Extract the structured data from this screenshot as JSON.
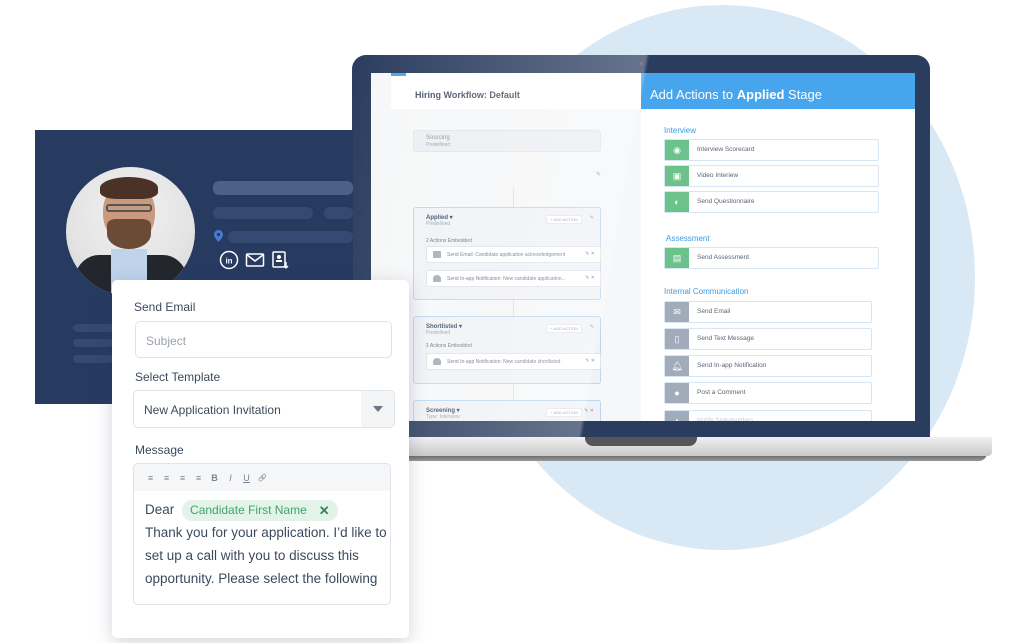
{
  "workflow": {
    "title": "Hiring Workflow: Default",
    "stages": [
      {
        "name": "Sourcing",
        "subtitle": "Predefined"
      },
      {
        "name": "Applied ▾",
        "subtitle": "Predefined",
        "add_action": "+ ADD ACTION",
        "actions_count": "2 Actions Embedded",
        "actions": [
          {
            "icon": "mail-icon",
            "text": "Send Email: Candidate application acknowledgement"
          },
          {
            "icon": "bell-icon",
            "text": "Send In-app Notification: New candidate application..."
          }
        ]
      },
      {
        "name": "Shortlisted ▾",
        "subtitle": "Predefined",
        "add_action": "+ ADD ACTION",
        "actions_count": "1 Actions Embedded",
        "actions": [
          {
            "icon": "bell-icon",
            "text": "Send In-app Notification: New candidate shortlisted"
          }
        ]
      },
      {
        "name": "Screening ▾",
        "subtitle": "Type: Interview",
        "add_action": "+ ADD ACTION"
      }
    ]
  },
  "actions_panel": {
    "title_prefix": "Add Actions to ",
    "title_bold": "Applied",
    "title_suffix": " Stage",
    "sections": [
      {
        "title": "Interview",
        "items": [
          "Interview Scorecard",
          "Video Interiew",
          "Send Questionnaire"
        ]
      },
      {
        "title": "Assessment",
        "items": [
          "Send Assessment"
        ]
      },
      {
        "title": "Internal Communication",
        "items": [
          "Send Email",
          "Send Text Message",
          "Send In-app Notification",
          "Post a Comment",
          "Notify Stakeholders"
        ]
      }
    ]
  },
  "email_form": {
    "title": "Send Email",
    "subject_placeholder": "Subject",
    "template_label": "Select Template",
    "template_value": "New Application Invitation",
    "message_label": "Message",
    "toolbar": [
      "≡",
      "≡",
      "≡",
      "≡",
      "B",
      "I",
      "U",
      "🔗"
    ],
    "greeting": "Dear",
    "merge_tag": "Candidate First Name",
    "merge_tag_remove": "✕",
    "body": "Thank you for your application. I’d like to set up a call with you to discuss this opportunity. Please select the following"
  },
  "colors": {
    "accent_blue": "#46a5ec",
    "navy": "#273a60",
    "green": "#6cc28b",
    "circle_bg": "#d9e8f5"
  }
}
